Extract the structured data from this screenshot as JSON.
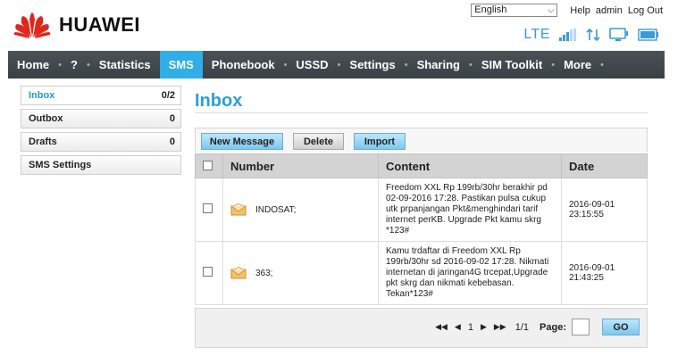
{
  "brand": {
    "name": "HUAWEI",
    "color": "#e1261c"
  },
  "top_links": {
    "language": "English",
    "help": "Help",
    "user": "admin",
    "logout": "Log Out"
  },
  "status": {
    "network": "LTE"
  },
  "nav": {
    "items": [
      "Home",
      "?",
      "Statistics",
      "SMS",
      "Phonebook",
      "USSD",
      "Settings",
      "Sharing",
      "SIM Toolkit",
      "More"
    ],
    "active": "SMS"
  },
  "sidebar": {
    "items": [
      {
        "label": "Inbox",
        "count": "0/2"
      },
      {
        "label": "Outbox",
        "count": "0"
      },
      {
        "label": "Drafts",
        "count": "0"
      },
      {
        "label": "SMS Settings",
        "count": ""
      }
    ]
  },
  "main": {
    "title": "Inbox",
    "buttons": {
      "new": "New Message",
      "delete": "Delete",
      "import": "Import"
    },
    "columns": {
      "number": "Number",
      "content": "Content",
      "date": "Date"
    },
    "rows": [
      {
        "number": "INDOSAT;",
        "content": "Freedom XXL Rp 199rb/30hr berakhir pd 02-09-2016 17:28. Pastikan pulsa cukup utk prpanjangan Pkt&menghindari tarif internet perKB. Upgrade Pkt kamu skrg *123#",
        "date": "2016-09-01 23:15:55"
      },
      {
        "number": "363;",
        "content": "Kamu trdaftar di Freedom XXL Rp 199rb/30hr sd 2016-09-02 17:28. Nikmati internetan di jaringan4G trcepat,Upgrade pkt skrg dan nikmati kebebasan. Tekan*123#",
        "date": "2016-09-01 21:43:25"
      }
    ]
  },
  "pager": {
    "current": "1",
    "range": "1/1",
    "page_label": "Page:",
    "go": "GO"
  }
}
